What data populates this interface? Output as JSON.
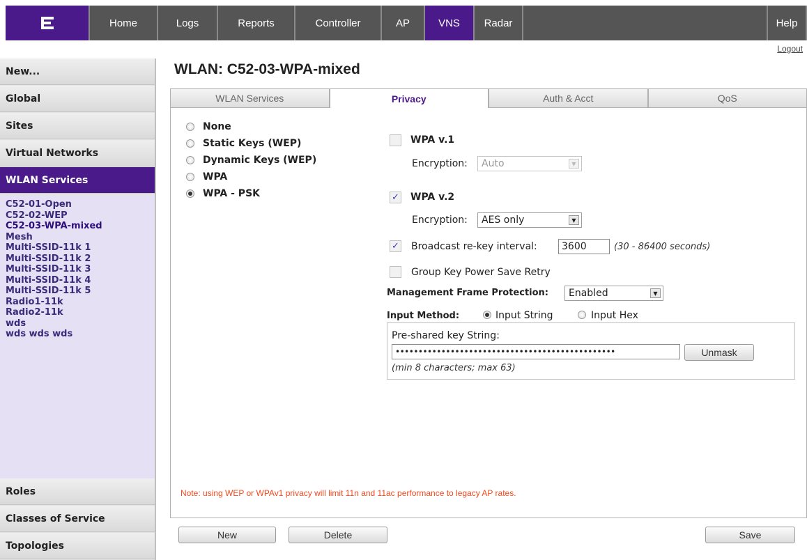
{
  "nav": {
    "items": [
      "Home",
      "Logs",
      "Reports",
      "Controller",
      "AP",
      "VNS",
      "Radar"
    ],
    "active": "VNS",
    "help_label": "Help",
    "logout_label": "Logout"
  },
  "sidebar": {
    "sections_top": [
      "New...",
      "Global",
      "Sites",
      "Virtual Networks",
      "WLAN Services"
    ],
    "active_section": "WLAN Services",
    "wlan_list": [
      "C52-01-Open",
      "C52-02-WEP",
      "C52-03-WPA-mixed",
      "Mesh",
      "Multi-SSID-11k 1",
      "Multi-SSID-11k 2",
      "Multi-SSID-11k 3",
      "Multi-SSID-11k 4",
      "Multi-SSID-11k 5",
      "Radio1-11k",
      "Radio2-11k",
      "wds",
      "wds wds wds"
    ],
    "current_wlan": "C52-03-WPA-mixed",
    "sections_bottom": [
      "Roles",
      "Classes of Service",
      "Topologies"
    ]
  },
  "page": {
    "title": "WLAN: C52-03-WPA-mixed",
    "tabs": [
      "WLAN Services",
      "Privacy",
      "Auth & Acct",
      "QoS"
    ],
    "active_tab": "Privacy"
  },
  "privacy": {
    "modes": [
      "None",
      "Static Keys (WEP)",
      "Dynamic Keys (WEP)",
      "WPA",
      "WPA - PSK"
    ],
    "selected_mode": "WPA - PSK",
    "wpa1": {
      "label": "WPA v.1",
      "checked": false,
      "encryption_label": "Encryption:",
      "encryption_value": "Auto"
    },
    "wpa2": {
      "label": "WPA v.2",
      "checked": true,
      "encryption_label": "Encryption:",
      "encryption_value": "AES only"
    },
    "rekey": {
      "label": "Broadcast re-key interval:",
      "checked": true,
      "value": "3600",
      "hint": "(30 - 86400 seconds)"
    },
    "group_key": {
      "label": "Group Key Power Save Retry",
      "checked": false
    },
    "mfp": {
      "label": "Management Frame Protection:",
      "value": "Enabled"
    },
    "input_method": {
      "label": "Input Method:",
      "options": [
        "Input String",
        "Input Hex"
      ],
      "selected": "Input String"
    },
    "psk": {
      "label": "Pre-shared key String:",
      "masked_value": "••••••••••••••••••••••••••••••••••••••••••••••••",
      "unmask_label": "Unmask",
      "hint": "(min 8 characters; max 63)"
    },
    "note": "Note: using WEP or WPAv1 privacy will limit 11n and 11ac performance to legacy AP rates."
  },
  "actions": {
    "new": "New",
    "delete": "Delete",
    "save": "Save"
  },
  "colors": {
    "brand_purple": "#4b1a8a",
    "note_red": "#f04a1e",
    "nav_gray": "#555555"
  }
}
